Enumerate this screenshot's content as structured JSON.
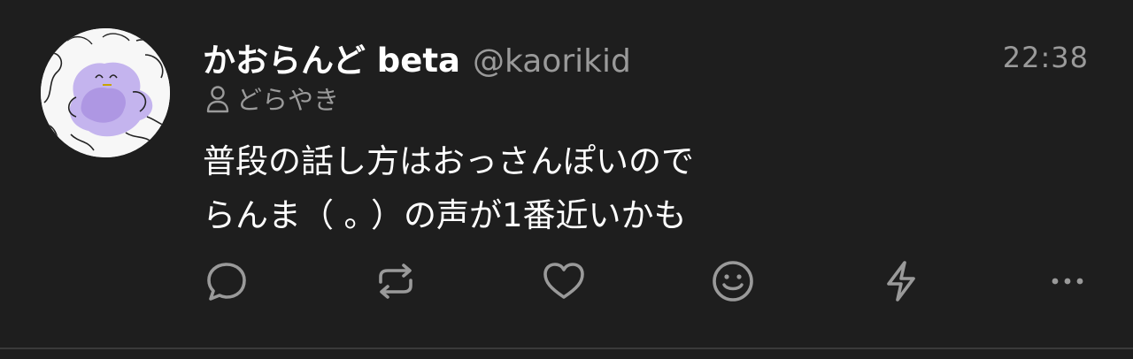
{
  "post": {
    "author_display_name": "かおらんど beta",
    "author_handle": "@kaorikid",
    "timestamp": "22:38",
    "role_label": "どらやき",
    "content": "普段の話し方はおっさんぽいので\nらんま（ ｡ ）の声が1番近いかも"
  },
  "actions": [
    {
      "name": "reply-icon"
    },
    {
      "name": "repost-icon"
    },
    {
      "name": "heart-icon"
    },
    {
      "name": "smile-icon"
    },
    {
      "name": "lightning-icon"
    },
    {
      "name": "more-icon"
    }
  ],
  "colors": {
    "background": "#1e1e1e",
    "text_primary": "#ffffff",
    "text_secondary": "#9a9a9a",
    "icon": "#9a9a9a",
    "divider": "#3a3a3a",
    "avatar_accent": "#b7a3e6"
  }
}
